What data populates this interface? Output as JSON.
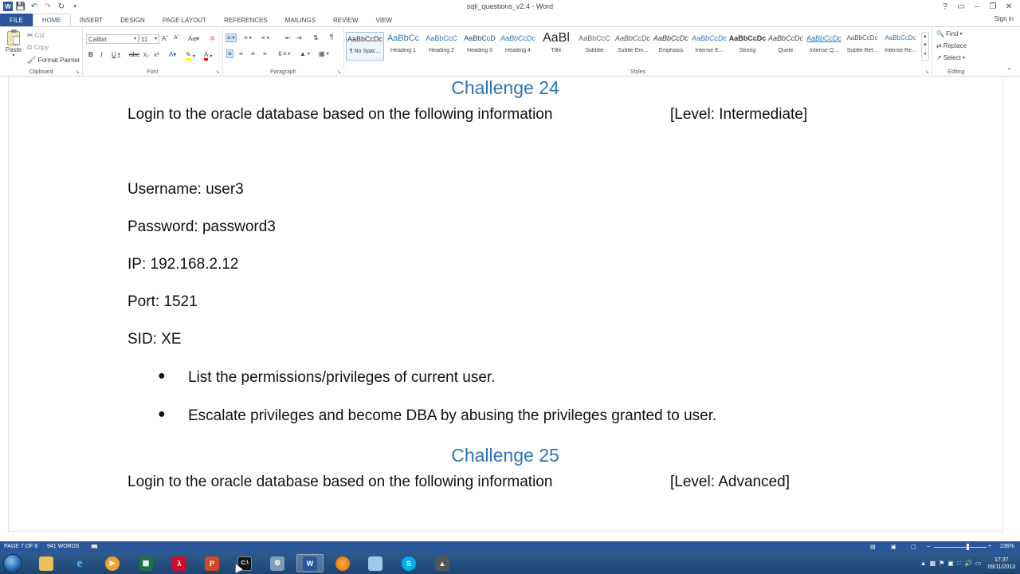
{
  "window": {
    "title": "sqli_questions_v2.4 - Word",
    "controls": [
      "?",
      "▭",
      "–",
      "❐",
      "✕"
    ],
    "sign_in": "Sign in"
  },
  "ribbon_tabs": [
    {
      "label": "FILE"
    },
    {
      "label": "HOME"
    },
    {
      "label": "INSERT"
    },
    {
      "label": "DESIGN"
    },
    {
      "label": "PAGE LAYOUT"
    },
    {
      "label": "REFERENCES"
    },
    {
      "label": "MAILINGS"
    },
    {
      "label": "REVIEW"
    },
    {
      "label": "VIEW"
    }
  ],
  "clipboard": {
    "paste": "Paste",
    "cut": "Cut",
    "copy": "Copy",
    "format_painter": "Format Painter",
    "group_label": "Clipboard"
  },
  "font": {
    "name": "Calibri",
    "size": "11",
    "group_label": "Font"
  },
  "paragraph": {
    "group_label": "Paragraph"
  },
  "styles": {
    "group_label": "Styles",
    "items": [
      {
        "sample": "AaBbCcDc",
        "name": "¶ No Spac..."
      },
      {
        "sample": "AaBbCc",
        "name": "Heading 1"
      },
      {
        "sample": "AaBbCcC",
        "name": "Heading 2"
      },
      {
        "sample": "AaBbCcD",
        "name": "Heading 3"
      },
      {
        "sample": "AaBbCcDc",
        "name": "Heading 4"
      },
      {
        "sample": "AaBl",
        "name": "Title"
      },
      {
        "sample": "AaBbCcC",
        "name": "Subtitle"
      },
      {
        "sample": "AaBbCcDc",
        "name": "Subtle Em..."
      },
      {
        "sample": "AaBbCcDc",
        "name": "Emphasis"
      },
      {
        "sample": "AaBbCcDc",
        "name": "Intense E..."
      },
      {
        "sample": "AaBbCcDc",
        "name": "Strong"
      },
      {
        "sample": "AaBbCcDc",
        "name": "Quote"
      },
      {
        "sample": "AaBbCcDc",
        "name": "Intense Q..."
      },
      {
        "sample": "AaBbCcDc",
        "name": "Subtle Ref..."
      },
      {
        "sample": "AaBbCcDc",
        "name": "Intense Re..."
      }
    ]
  },
  "editing": {
    "find": "Find",
    "replace": "Replace",
    "select": "Select",
    "group_label": "Editing"
  },
  "document": {
    "challenge24": {
      "heading": "Challenge 24",
      "intro": "Login to the oracle database based on the following information",
      "level": "[Level: Intermediate]",
      "username": "Username: user3",
      "password": "Password: password3",
      "ip": "IP: 192.168.2.12",
      "port": "Port: 1521",
      "sid": "SID: XE",
      "bullets": [
        "List the permissions/privileges of current user.",
        "Escalate privileges and become DBA by abusing the privileges granted to user."
      ]
    },
    "challenge25": {
      "heading": "Challenge 25",
      "intro": "Login to the oracle database based on the following information",
      "level": "[Level: Advanced]"
    }
  },
  "status_bar": {
    "page": "PAGE 7 OF 8",
    "words": "941 WORDS",
    "zoom": "236%"
  },
  "taskbar": {
    "clock_time": "17:37",
    "clock_date": "09/11/2013"
  },
  "colors": {
    "accent": "#2b579a",
    "heading": "#2e74b5"
  }
}
